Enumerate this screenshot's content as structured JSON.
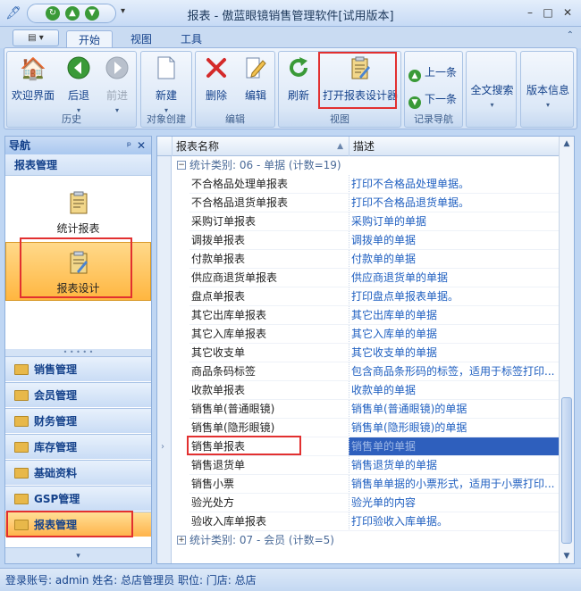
{
  "window": {
    "title": "报表 - 傲蓝眼镜销售管理软件[试用版本]",
    "controls": [
      "minimize-icon",
      "maximize-icon",
      "close-icon"
    ]
  },
  "quick_access": [
    "undo-icon",
    "forward-icon",
    "back-icon"
  ],
  "tabs": [
    {
      "label": "开始",
      "active": true
    },
    {
      "label": "视图",
      "active": false
    },
    {
      "label": "工具",
      "active": false
    }
  ],
  "ribbon": {
    "groups": [
      {
        "label": "历史",
        "buttons": [
          {
            "label": "欢迎界面",
            "icon": "home-icon"
          },
          {
            "label": "后退",
            "icon": "back-icon"
          },
          {
            "label": "前进",
            "icon": "forward-icon",
            "disabled": true
          }
        ]
      },
      {
        "label": "对象创建",
        "buttons": [
          {
            "label": "新建",
            "icon": "new-document-icon"
          }
        ]
      },
      {
        "label": "编辑",
        "buttons": [
          {
            "label": "删除",
            "icon": "delete-icon"
          },
          {
            "label": "编辑",
            "icon": "edit-icon"
          }
        ]
      },
      {
        "label": "视图",
        "buttons": [
          {
            "label": "刷新",
            "icon": "refresh-icon"
          },
          {
            "label": "打开报表设计器",
            "icon": "report-designer-icon"
          }
        ]
      },
      {
        "label": "记录导航",
        "buttons": [
          {
            "label": "上一条",
            "icon": "up-icon"
          },
          {
            "label": "下一条",
            "icon": "down-icon"
          }
        ]
      },
      {
        "label": "",
        "buttons": [
          {
            "label": "全文搜索",
            "icon": "dropdown-icon"
          }
        ]
      },
      {
        "label": "",
        "buttons": [
          {
            "label": "版本信息",
            "icon": "dropdown-icon"
          }
        ]
      }
    ]
  },
  "nav": {
    "header": "导航",
    "section": "报表管理",
    "items": [
      {
        "label": "统计报表",
        "icon": "clipboard-icon"
      },
      {
        "label": "报表设计",
        "icon": "clipboard-edit-icon",
        "selected": true
      }
    ],
    "categories": [
      {
        "label": "销售管理"
      },
      {
        "label": "会员管理"
      },
      {
        "label": "财务管理"
      },
      {
        "label": "库存管理"
      },
      {
        "label": "基础资料"
      },
      {
        "label": "GSP管理"
      },
      {
        "label": "报表管理",
        "active": true
      }
    ]
  },
  "grid": {
    "columns": [
      "报表名称",
      "描述"
    ],
    "group1": "统计类别: 06 - 单据 (计数=19)",
    "rows": [
      [
        "不合格品处理单报表",
        "打印不合格品处理单据。"
      ],
      [
        "不合格品退货单报表",
        "打印不合格品退货单据。"
      ],
      [
        "采购订单报表",
        "采购订单的单据"
      ],
      [
        "调拨单报表",
        "调拨单的单据"
      ],
      [
        "付款单报表",
        "付款单的单据"
      ],
      [
        "供应商退货单报表",
        "供应商退货单的单据"
      ],
      [
        "盘点单报表",
        "打印盘点单报表单据。"
      ],
      [
        "其它出库单报表",
        "其它出库单的单据"
      ],
      [
        "其它入库单报表",
        "其它入库单的单据"
      ],
      [
        "其它收支单",
        "其它收支单的单据"
      ],
      [
        "商品条码标签",
        "包含商品条形码的标签，适用于标签打印..."
      ],
      [
        "收款单报表",
        "收款单的单据"
      ],
      [
        "销售单(普通眼镜)",
        "销售单(普通眼镜)的单据"
      ],
      [
        "销售单(隐形眼镜)",
        "销售单(隐形眼镜)的单据"
      ],
      [
        "销售单报表",
        "销售单的单据"
      ],
      [
        "销售退货单",
        "销售退货单的单据"
      ],
      [
        "销售小票",
        "销售单单据的小票形式，适用于小票打印..."
      ],
      [
        "验光处方",
        "验光单的内容"
      ],
      [
        "验收入库单报表",
        "打印验收入库单据。"
      ]
    ],
    "selected_index": 14,
    "group2": "统计类别: 07 - 会员 (计数=5)"
  },
  "status": {
    "text": "登录账号: admin 姓名: 总店管理员 职位: 门店: 总店"
  }
}
